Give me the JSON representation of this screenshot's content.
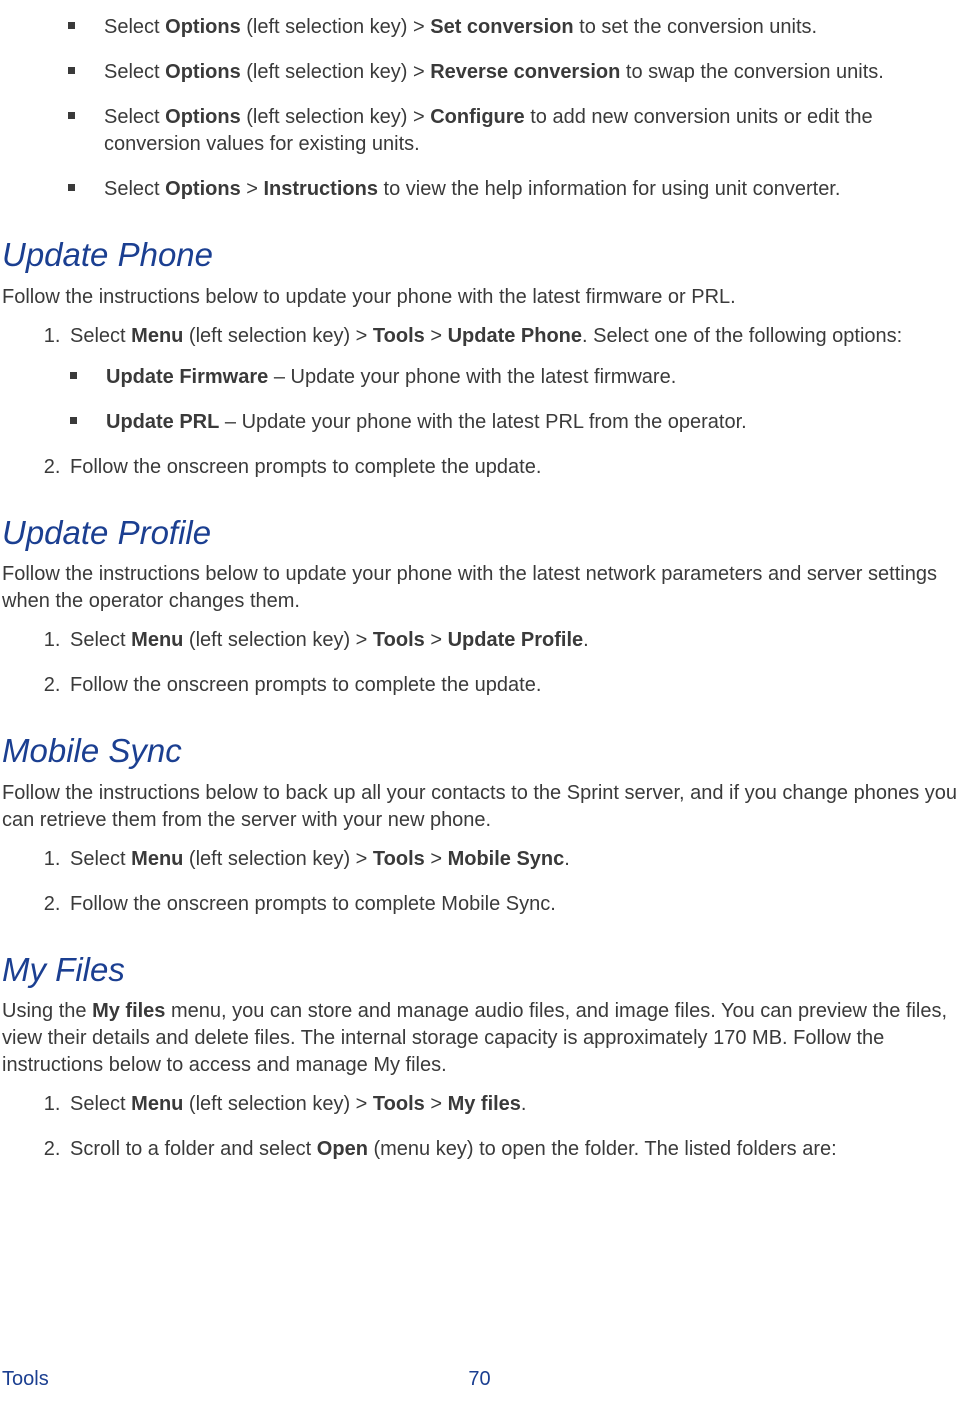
{
  "topBullets": [
    {
      "pre": "Select ",
      "b1": "Options",
      "mid1": " (left selection key) > ",
      "b2": "Set conversion",
      "tail": " to set the conversion units."
    },
    {
      "pre": "Select ",
      "b1": "Options",
      "mid1": " (left selection key) > ",
      "b2": "Reverse conversion",
      "tail": " to swap the conversion units."
    },
    {
      "pre": "Select ",
      "b1": "Options",
      "mid1": " (left selection key) > ",
      "b2": "Configure",
      "tail": " to add new conversion units or edit the conversion values for existing units."
    },
    {
      "pre": "Select ",
      "b1": "Options",
      "mid1": " > ",
      "b2": "Instructions",
      "tail": " to view the help information for using unit converter."
    }
  ],
  "updatePhone": {
    "heading": "Update Phone",
    "intro": "Follow the instructions below to update your phone with the latest firmware or PRL.",
    "step1_pre": "Select ",
    "step1_b1": "Menu",
    "step1_mid1": " (left selection key) > ",
    "step1_b2": "Tools",
    "step1_mid2": " > ",
    "step1_b3": "Update Phone",
    "step1_tail": ". Select one of the following options:",
    "sub1_b": "Update Firmware",
    "sub1_tail": " – Update your phone with the latest firmware.",
    "sub2_b": "Update PRL",
    "sub2_tail": " – Update your phone with the latest PRL from the operator.",
    "step2": "Follow the onscreen prompts to complete the update."
  },
  "updateProfile": {
    "heading": "Update Profile",
    "intro": "Follow the instructions below to update your phone with the latest network parameters and server settings when the operator changes them.",
    "step1_pre": "Select ",
    "step1_b1": "Menu",
    "step1_mid1": " (left selection key) > ",
    "step1_b2": "Tools",
    "step1_mid2": " > ",
    "step1_b3": "Update Profile",
    "step1_tail": ".",
    "step2": "Follow the onscreen prompts to complete the update."
  },
  "mobileSync": {
    "heading": "Mobile Sync",
    "intro": "Follow the instructions below to back up all your contacts to the Sprint server, and if you change phones you can retrieve them from the server with your new phone.",
    "step1_pre": "Select ",
    "step1_b1": "Menu",
    "step1_mid1": " (left selection key) > ",
    "step1_b2": "Tools",
    "step1_mid2": " > ",
    "step1_b3": "Mobile Sync",
    "step1_tail": ".",
    "step2": "Follow the onscreen prompts to complete Mobile Sync."
  },
  "myFiles": {
    "heading": "My Files",
    "intro_pre": "Using the ",
    "intro_b": "My files",
    "intro_tail": " menu, you can store and manage audio files, and image files. You can preview the files, view their details and delete files. The internal storage capacity is approximately 170 MB. Follow the instructions below to access and manage My files.",
    "step1_pre": "Select ",
    "step1_b1": "Menu",
    "step1_mid1": " (left selection key) > ",
    "step1_b2": "Tools",
    "step1_mid2": " > ",
    "step1_b3": "My files",
    "step1_tail": ".",
    "step2_pre": "Scroll to a folder and select ",
    "step2_b": "Open",
    "step2_tail": " (menu key) to open the folder. The listed folders are:"
  },
  "footer": {
    "left": "Tools",
    "page": "70"
  }
}
